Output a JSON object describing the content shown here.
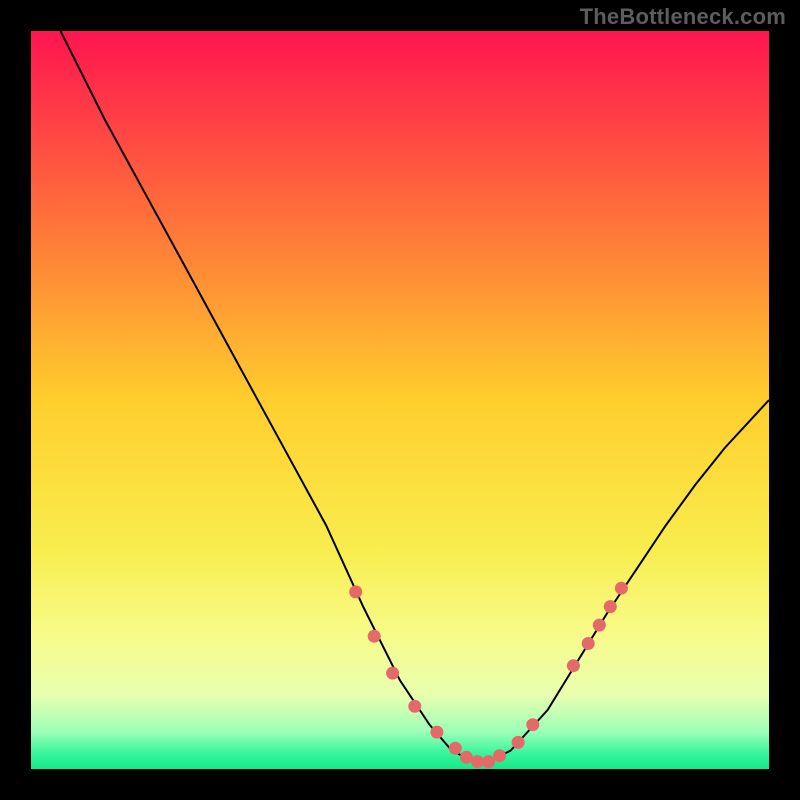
{
  "watermark": "TheBottleneck.com",
  "chart_data": {
    "type": "line",
    "title": "",
    "xlabel": "",
    "ylabel": "",
    "xlim": [
      0,
      100
    ],
    "ylim": [
      0,
      100
    ],
    "grid": false,
    "legend": false,
    "background": {
      "type": "vertical-gradient",
      "stops": [
        {
          "offset": 0.0,
          "color": "#ff1450"
        },
        {
          "offset": 0.25,
          "color": "#ff6f3a"
        },
        {
          "offset": 0.5,
          "color": "#ffce2d"
        },
        {
          "offset": 0.7,
          "color": "#f8ed4d"
        },
        {
          "offset": 0.82,
          "color": "#f7fb8a"
        },
        {
          "offset": 0.9,
          "color": "#e8ffb0"
        },
        {
          "offset": 0.95,
          "color": "#9bffb8"
        },
        {
          "offset": 0.98,
          "color": "#34f59a"
        },
        {
          "offset": 1.0,
          "color": "#17e886"
        }
      ]
    },
    "series": [
      {
        "name": "bottleneck-curve",
        "color": "#000000",
        "x": [
          4.0,
          10.0,
          16.0,
          22.0,
          28.0,
          34.0,
          40.0,
          45.0,
          50.0,
          54.0,
          57.0,
          60.0,
          62.0,
          65.0,
          70.0,
          74.0,
          78.0,
          82.0,
          86.0,
          90.0,
          94.0,
          100.0
        ],
        "values": [
          100.0,
          88.0,
          77.0,
          66.0,
          55.0,
          44.0,
          33.0,
          22.0,
          12.0,
          6.0,
          2.5,
          1.0,
          1.0,
          2.5,
          8.0,
          14.5,
          21.0,
          27.0,
          33.0,
          38.5,
          43.5,
          50.0
        ]
      }
    ],
    "markers": {
      "name": "highlight-dots",
      "color": "#e46a6a",
      "radius_px": 6.5,
      "x": [
        44.0,
        46.5,
        49.0,
        52.0,
        55.0,
        57.5,
        59.0,
        60.5,
        62.0,
        63.5,
        66.0,
        68.0,
        73.5,
        75.5,
        77.0,
        78.5,
        80.0
      ],
      "values": [
        24.0,
        18.0,
        13.0,
        8.5,
        5.0,
        2.8,
        1.6,
        1.0,
        1.0,
        1.8,
        3.6,
        6.0,
        14.0,
        17.0,
        19.5,
        22.0,
        24.5
      ]
    }
  }
}
